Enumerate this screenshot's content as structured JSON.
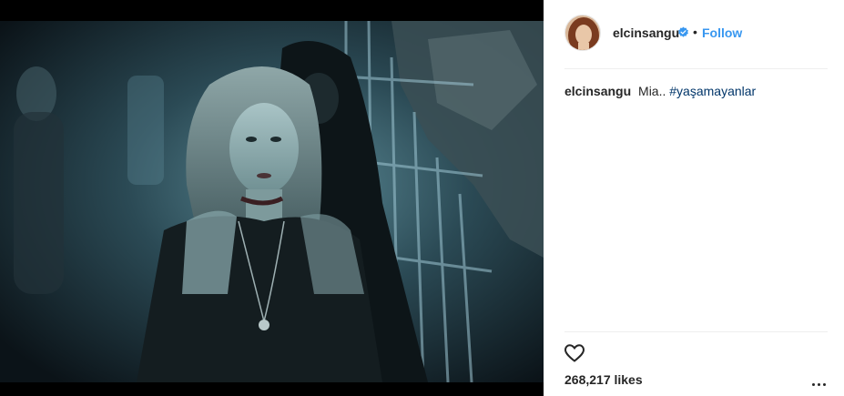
{
  "post": {
    "username": "elcinsangu",
    "follow_label": "Follow",
    "separator": "•",
    "caption_user": "elcinsangu",
    "caption_text": "Mia..",
    "caption_hashtag": "#yaşamayanlar",
    "likes": "268,217 likes",
    "verified_icon": "verified-badge-icon",
    "like_icon": "heart-outline-icon",
    "more_icon": "more-options-icon"
  },
  "colors": {
    "follow": "#3897f0",
    "hashtag": "#003569",
    "text": "#262626",
    "divider": "#efefef"
  }
}
